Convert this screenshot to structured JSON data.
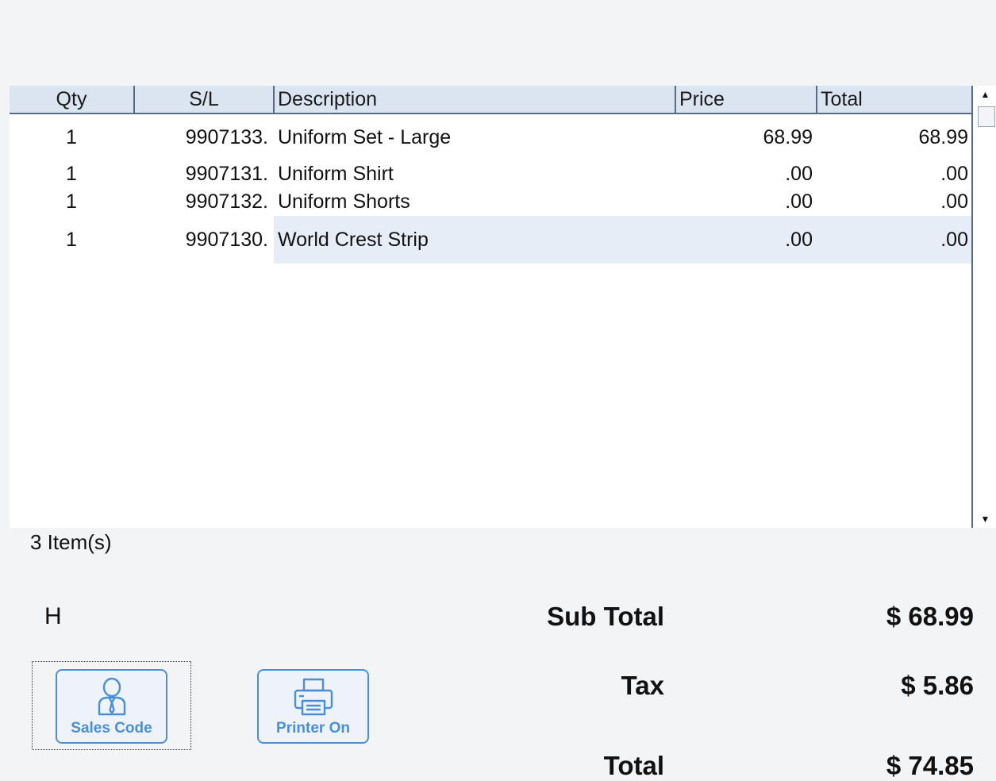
{
  "grid": {
    "headers": {
      "qty": "Qty",
      "sl": "S/L",
      "description": "Description",
      "price": "Price",
      "total": "Total"
    },
    "rows": [
      {
        "qty": "1",
        "sl": "9907133.",
        "description": "Uniform Set - Large",
        "price": "68.99",
        "total": "68.99"
      },
      {
        "qty": "1",
        "sl": "9907131.",
        "description": "Uniform Shirt",
        "price": ".00",
        "total": ".00"
      },
      {
        "qty": "1",
        "sl": "9907132.",
        "description": "Uniform Shorts",
        "price": ".00",
        "total": ".00"
      },
      {
        "qty": "1",
        "sl": "9907130.",
        "description": "World Crest Strip",
        "price": ".00",
        "total": ".00"
      }
    ]
  },
  "item_count": "3 Item(s)",
  "status_letter": "H",
  "totals": {
    "subtotal_label": "Sub Total",
    "subtotal_value": "$ 68.99",
    "tax_label": "Tax",
    "tax_value": "$ 5.86",
    "total_label": "Total",
    "total_value": "$ 74.85"
  },
  "buttons": {
    "sales_code": {
      "label": "Sales Code",
      "icon": "salesperson-icon"
    },
    "printer": {
      "label": "Printer On",
      "icon": "printer-icon"
    }
  },
  "colors": {
    "accent": "#4a8ed8",
    "header_bg": "#dbe5f1",
    "selected_row": "#e6edf6"
  }
}
